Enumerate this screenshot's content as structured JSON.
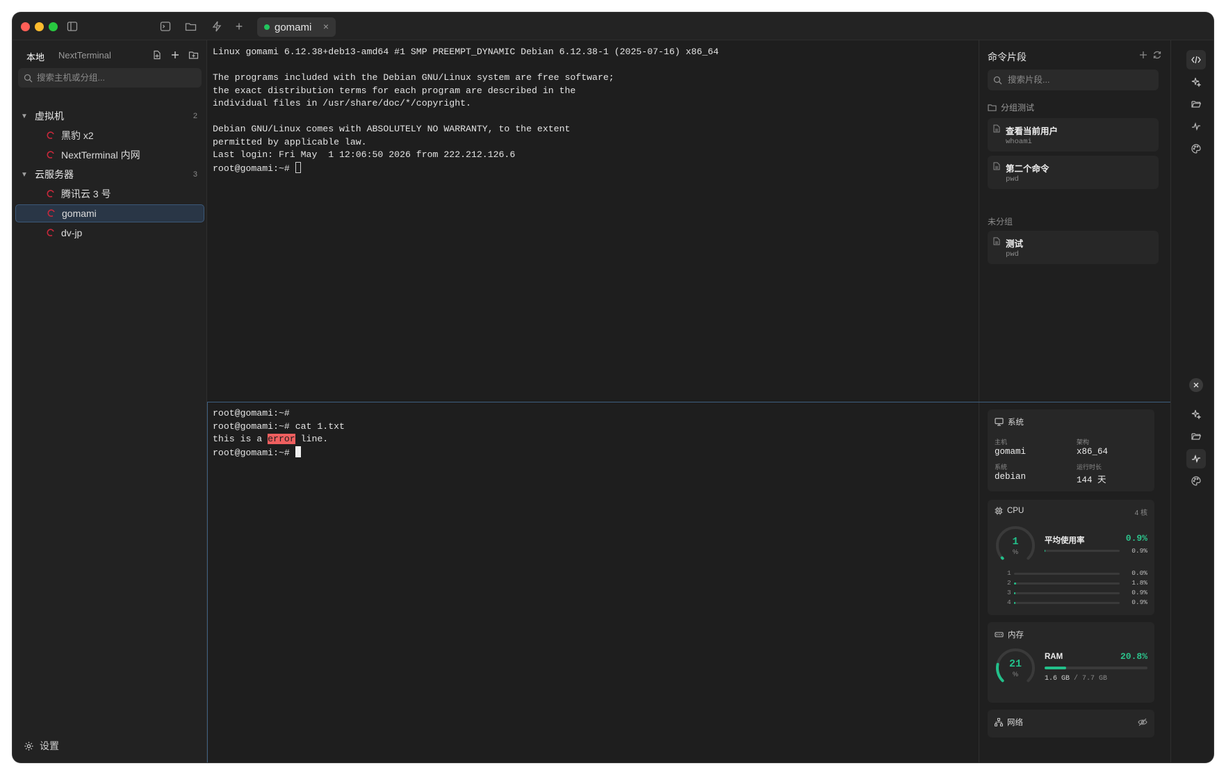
{
  "titlebar": {
    "tab_label": "gomami",
    "tab_close": "×",
    "colors": {
      "close": "#ff5f57",
      "minimize": "#febc2e",
      "zoom": "#28c840",
      "online": "#22c55e"
    }
  },
  "sidebar": {
    "tabs": [
      "本地",
      "NextTerminal"
    ],
    "search_placeholder": "搜索主机或分组...",
    "groups": [
      {
        "label": "虚拟机",
        "count": "2",
        "hosts": [
          "黑豹 x2",
          "NextTerminal 内网"
        ]
      },
      {
        "label": "云服务器",
        "count": "3",
        "hosts": [
          "腾讯云 3 号",
          "gomami",
          "dv-jp"
        ]
      }
    ],
    "selected_host": "gomami",
    "settings_label": "设置"
  },
  "terminal_top": {
    "lines": [
      "Linux gomami 6.12.38+deb13-amd64 #1 SMP PREEMPT_DYNAMIC Debian 6.12.38-1 (2025-07-16) x86_64",
      "",
      "The programs included with the Debian GNU/Linux system are free software;",
      "the exact distribution terms for each program are described in the",
      "individual files in /usr/share/doc/*/copyright.",
      "",
      "Debian GNU/Linux comes with ABSOLUTELY NO WARRANTY, to the extent",
      "permitted by applicable law.",
      "Last login: Fri May  1 12:06:50 2026 from 222.212.126.6"
    ],
    "prompt": "root@gomami:~# "
  },
  "terminal_bottom": {
    "line1": "root@gomami:~#",
    "line2": "root@gomami:~# cat 1.txt",
    "line3_pre": "this is a ",
    "line3_highlight": "error",
    "line3_post": " line.",
    "prompt": "root@gomami:~# "
  },
  "snippets": {
    "title": "命令片段",
    "search_placeholder": "搜索片段...",
    "group_name": "分组测试",
    "group_items": [
      {
        "title": "查看当前用户",
        "command": "whoami"
      },
      {
        "title": "第二个命令",
        "command": "pwd"
      }
    ],
    "ungrouped_label": "未分组",
    "ungrouped_items": [
      {
        "title": "测试",
        "command": "pwd"
      }
    ]
  },
  "monitor": {
    "system": {
      "title": "系统",
      "host_label": "主机",
      "host": "gomami",
      "arch_label": "架构",
      "arch": "x86_64",
      "os_label": "系统",
      "os": "debian",
      "uptime_label": "运行时长",
      "uptime": "144 天"
    },
    "cpu": {
      "title": "CPU",
      "cores": "4 核",
      "gauge_value": "1",
      "gauge_unit": "%",
      "gauge_fraction": 0.01,
      "avg_label": "平均使用率",
      "avg_value": "0.9%",
      "avg_bar_value": "0.9%",
      "avg_fraction": 0.009,
      "per_core": [
        {
          "idx": "1",
          "value": "0.0%",
          "fraction": 0.0
        },
        {
          "idx": "2",
          "value": "1.8%",
          "fraction": 0.018
        },
        {
          "idx": "3",
          "value": "0.9%",
          "fraction": 0.009
        },
        {
          "idx": "4",
          "value": "0.9%",
          "fraction": 0.009
        }
      ]
    },
    "memory": {
      "title": "内存",
      "gauge_value": "21",
      "gauge_unit": "%",
      "gauge_fraction": 0.21,
      "ram_label": "RAM",
      "ram_percent": "20.8%",
      "ram_fraction": 0.208,
      "used": "1.6 GB",
      "separator": "/",
      "total": "7.7 GB"
    },
    "network": {
      "title": "网络"
    }
  },
  "rail_icons": [
    "code-icon",
    "sparkle-icon",
    "folder-icon",
    "activity-icon",
    "palette-icon"
  ]
}
